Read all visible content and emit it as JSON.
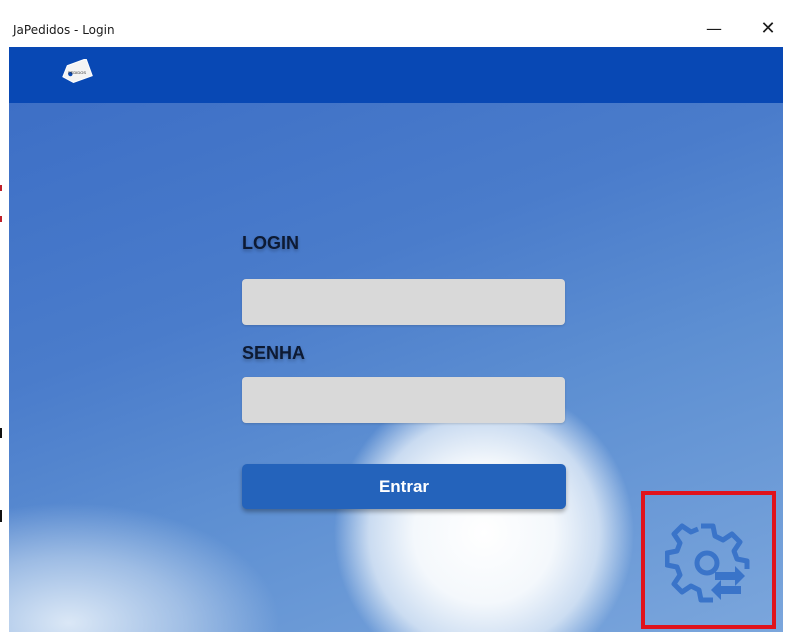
{
  "window": {
    "title": "JaPedidos - Login",
    "minimize_glyph": "—",
    "close_glyph": "✕"
  },
  "appbar": {
    "logo_icon": "pedidos-tag-logo-icon",
    "logo_text": "PEDIDOS",
    "color": "#0848b4"
  },
  "form": {
    "login_label": "LOGIN",
    "login_value": "",
    "senha_label": "SENHA",
    "senha_value": "",
    "submit_label": "Entrar"
  },
  "settings": {
    "icon": "gear-sync-icon",
    "highlight_color": "#e0131c"
  },
  "colors": {
    "button": "#2463bb",
    "field": "#d9d9d9"
  }
}
